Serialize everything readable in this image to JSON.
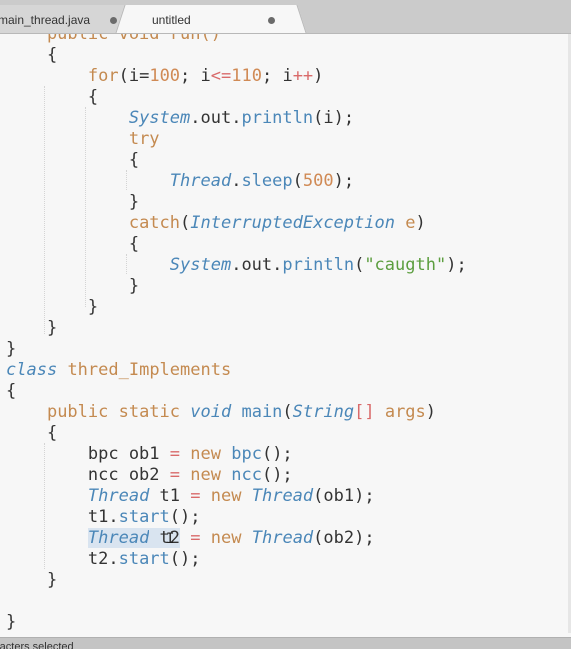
{
  "tabs": [
    {
      "label": "main_thread.java",
      "active": false,
      "dirty": true
    },
    {
      "label": "untitled",
      "active": true,
      "dirty": true
    }
  ],
  "status": {
    "text": "racters selected"
  },
  "colors": {
    "keyword": "#c48a50",
    "type": "#4b87b8",
    "number": "#d08a55",
    "operator": "#d96a6a",
    "string": "#5c9e3f",
    "plain": "#333333"
  },
  "code_lines": [
    [
      [
        "kw",
        "    public void run()"
      ]
    ],
    [
      [
        "p",
        "    {"
      ]
    ],
    [
      [
        "p",
        "        "
      ],
      [
        "kw",
        "for"
      ],
      [
        "p",
        "(i="
      ],
      [
        "num",
        "100"
      ],
      [
        "p",
        "; i"
      ],
      [
        "op",
        "<="
      ],
      [
        "num",
        "110"
      ],
      [
        "p",
        "; i"
      ],
      [
        "op",
        "++"
      ],
      [
        "p",
        ")"
      ]
    ],
    [
      [
        "p",
        "        {"
      ]
    ],
    [
      [
        "p",
        "            "
      ],
      [
        "ty",
        "System"
      ],
      [
        "p",
        "."
      ],
      [
        "p",
        "out"
      ],
      [
        "p",
        "."
      ],
      [
        "fn",
        "println"
      ],
      [
        "p",
        "(i);"
      ]
    ],
    [
      [
        "p",
        "            "
      ],
      [
        "kw",
        "try"
      ]
    ],
    [
      [
        "p",
        "            {"
      ]
    ],
    [
      [
        "p",
        "                "
      ],
      [
        "ty",
        "Thread"
      ],
      [
        "p",
        "."
      ],
      [
        "fn",
        "sleep"
      ],
      [
        "p",
        "("
      ],
      [
        "num",
        "500"
      ],
      [
        "p",
        ");"
      ]
    ],
    [
      [
        "p",
        "            }"
      ]
    ],
    [
      [
        "p",
        "            "
      ],
      [
        "kw",
        "catch"
      ],
      [
        "p",
        "("
      ],
      [
        "ty",
        "InterruptedException"
      ],
      [
        "p",
        " "
      ],
      [
        "kw",
        "e"
      ],
      [
        "p",
        ")"
      ]
    ],
    [
      [
        "p",
        "            {"
      ]
    ],
    [
      [
        "p",
        "                "
      ],
      [
        "ty",
        "System"
      ],
      [
        "p",
        "."
      ],
      [
        "p",
        "out"
      ],
      [
        "p",
        "."
      ],
      [
        "fn",
        "println"
      ],
      [
        "p",
        "("
      ],
      [
        "str",
        "\"caugth\""
      ],
      [
        "p",
        ");"
      ]
    ],
    [
      [
        "p",
        "            }"
      ]
    ],
    [
      [
        "p",
        "        }"
      ]
    ],
    [
      [
        "p",
        "    }"
      ]
    ],
    [
      [
        "p",
        "}"
      ]
    ],
    [
      [
        "ty",
        "class"
      ],
      [
        "p",
        " "
      ],
      [
        "kw",
        "thred_Implements"
      ]
    ],
    [
      [
        "p",
        "{"
      ]
    ],
    [
      [
        "p",
        "    "
      ],
      [
        "kw",
        "public static"
      ],
      [
        "p",
        " "
      ],
      [
        "ty",
        "void"
      ],
      [
        "p",
        " "
      ],
      [
        "fn",
        "main"
      ],
      [
        "p",
        "("
      ],
      [
        "ty",
        "String"
      ],
      [
        "op",
        "[]"
      ],
      [
        "p",
        " "
      ],
      [
        "kw",
        "args"
      ],
      [
        "p",
        ")"
      ]
    ],
    [
      [
        "p",
        "    {"
      ]
    ],
    [
      [
        "p",
        "        bpc ob1 "
      ],
      [
        "op",
        "="
      ],
      [
        "p",
        " "
      ],
      [
        "kw",
        "new"
      ],
      [
        "p",
        " "
      ],
      [
        "fn",
        "bpc"
      ],
      [
        "p",
        "();"
      ]
    ],
    [
      [
        "p",
        "        ncc ob2 "
      ],
      [
        "op",
        "="
      ],
      [
        "p",
        " "
      ],
      [
        "kw",
        "new"
      ],
      [
        "p",
        " "
      ],
      [
        "fn",
        "ncc"
      ],
      [
        "p",
        "();"
      ]
    ],
    [
      [
        "p",
        "        "
      ],
      [
        "ty",
        "Thread"
      ],
      [
        "p",
        " t1 "
      ],
      [
        "op",
        "="
      ],
      [
        "p",
        " "
      ],
      [
        "kw",
        "new"
      ],
      [
        "p",
        " "
      ],
      [
        "ty",
        "Thread"
      ],
      [
        "p",
        "(ob1);"
      ]
    ],
    [
      [
        "p",
        "        t1."
      ],
      [
        "fn",
        "start"
      ],
      [
        "p",
        "();"
      ]
    ],
    [
      [
        "p",
        "        "
      ],
      [
        "sel-ty",
        "Thread"
      ],
      [
        "sel",
        " t2"
      ],
      [
        "p",
        " "
      ],
      [
        "op",
        "="
      ],
      [
        "p",
        " "
      ],
      [
        "kw",
        "new"
      ],
      [
        "p",
        " "
      ],
      [
        "ty",
        "Thread"
      ],
      [
        "p",
        "(ob2);"
      ]
    ],
    [
      [
        "p",
        "        t2."
      ],
      [
        "fn",
        "start"
      ],
      [
        "p",
        "();"
      ]
    ],
    [
      [
        "p",
        "    }"
      ]
    ],
    [
      [
        "p",
        ""
      ]
    ],
    [
      [
        "p",
        "}"
      ]
    ]
  ]
}
